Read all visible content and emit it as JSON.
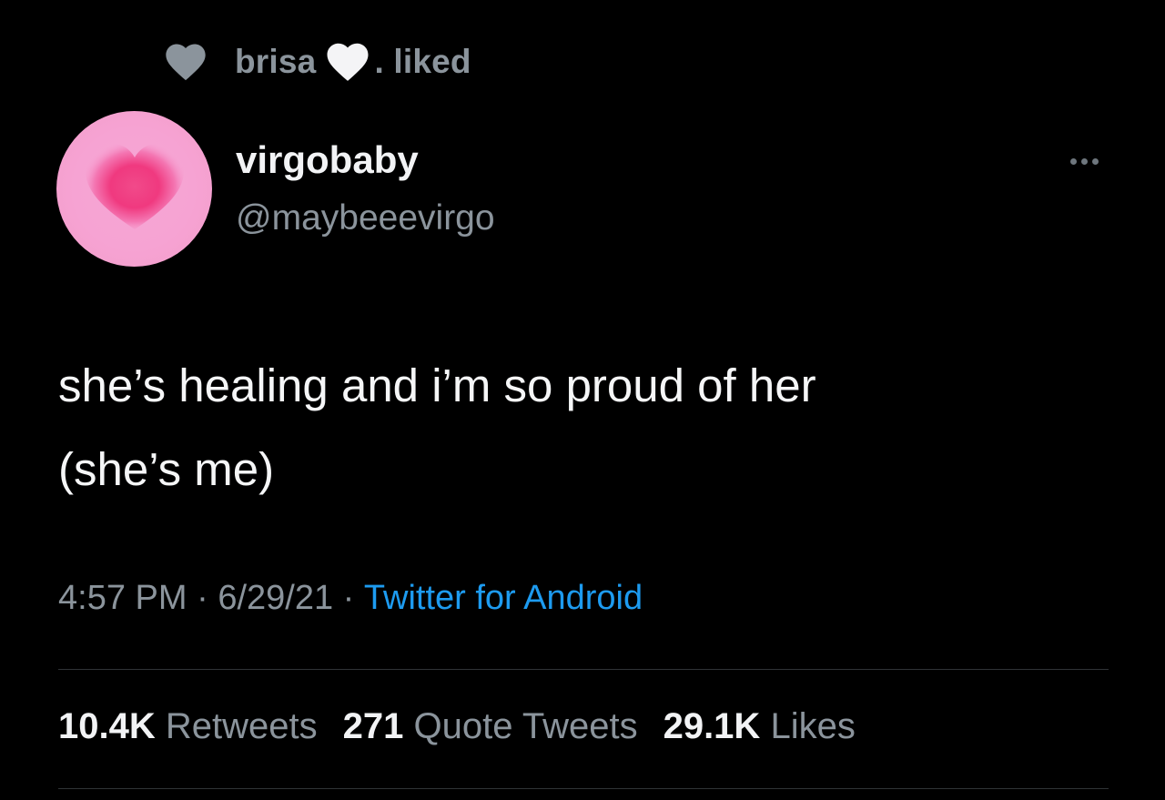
{
  "social_context": {
    "name": "brisa",
    "suffix": ". liked",
    "icons": [
      "heart-icon-gray",
      "heart-icon-white"
    ]
  },
  "author": {
    "display_name": "virgobaby",
    "handle": "@maybeeevirgo",
    "avatar": "pink-heart-avatar"
  },
  "tweet": {
    "text": "she’s healing and i’m so proud of her\n(she’s me)"
  },
  "meta": {
    "time": "4:57 PM",
    "separator": " · ",
    "date": "6/29/21",
    "source": "Twitter for Android"
  },
  "stats": {
    "retweets_count": "10.4K",
    "retweets_label": "Retweets",
    "quotes_count": "271",
    "quotes_label": "Quote Tweets",
    "likes_count": "29.1K",
    "likes_label": "Likes"
  },
  "colors": {
    "background": "#000000",
    "secondary_text": "#8b949c",
    "link": "#1d9bf0",
    "avatar_pink": "#f6a3d3",
    "heart_pink": "#f0397f"
  }
}
